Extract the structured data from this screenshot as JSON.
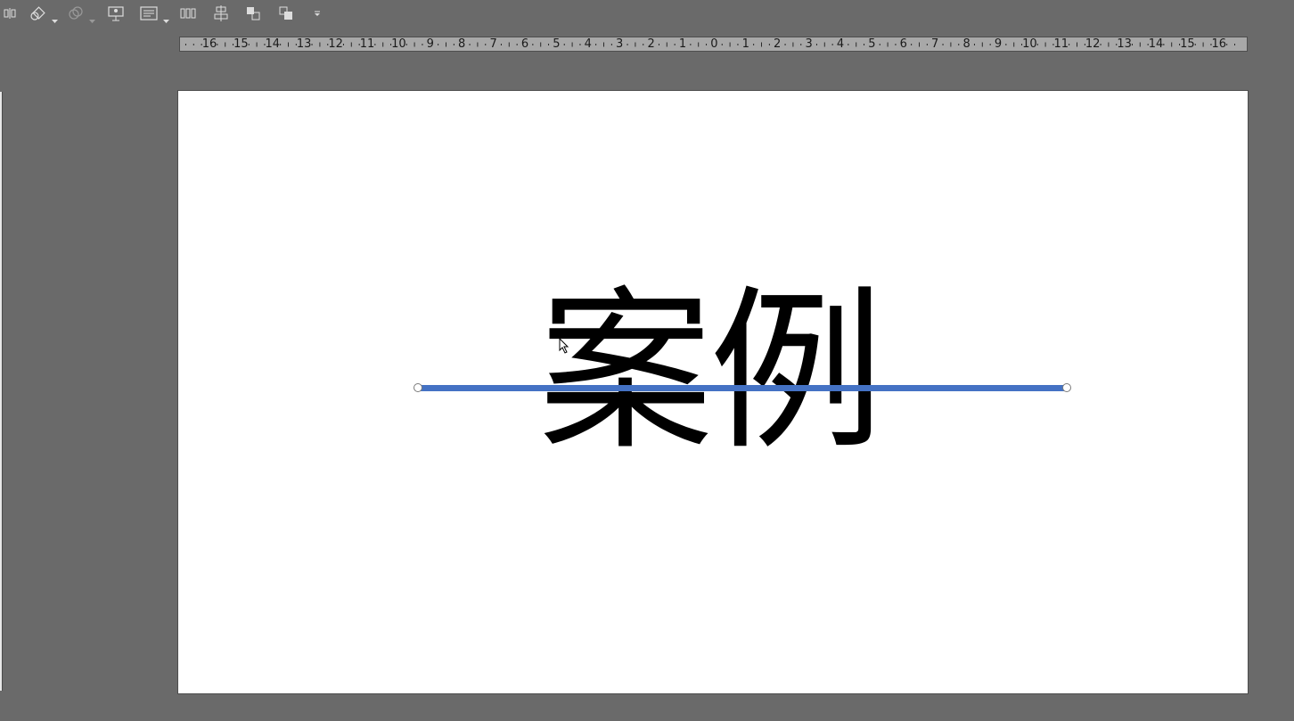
{
  "toolbar": {
    "buttons": [
      {
        "name": "distribute-icon"
      },
      {
        "name": "shape-fill-icon"
      },
      {
        "name": "merge-shapes-icon"
      },
      {
        "name": "presenter-icon"
      },
      {
        "name": "text-box-icon"
      },
      {
        "name": "distribute-horizontal-icon"
      },
      {
        "name": "align-center-icon"
      },
      {
        "name": "bring-forward-icon"
      },
      {
        "name": "send-backward-icon"
      },
      {
        "name": "more-icon"
      }
    ]
  },
  "ruler": {
    "labels": [
      "16",
      "15",
      "14",
      "13",
      "12",
      "11",
      "10",
      "9",
      "8",
      "7",
      "6",
      "5",
      "4",
      "3",
      "2",
      "1",
      "0",
      "1",
      "2",
      "3",
      "4",
      "5",
      "6",
      "7",
      "8",
      "9",
      "10",
      "11",
      "12",
      "13",
      "14",
      "15",
      "16"
    ]
  },
  "slide": {
    "text": "案例",
    "line_color": "#4472c4",
    "text_color": "#000000",
    "background": "#ffffff"
  },
  "colors": {
    "app_background": "#6a6a6a",
    "ruler_background": "#a8a8a8"
  }
}
